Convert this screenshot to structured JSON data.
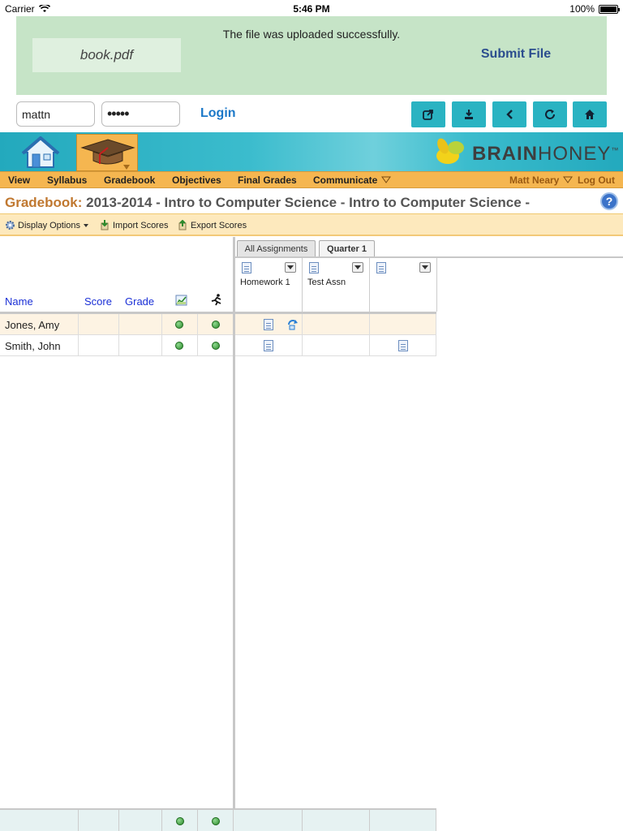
{
  "status_bar": {
    "carrier": "Carrier",
    "time": "5:46 PM",
    "battery": "100%"
  },
  "upload": {
    "message": "The file was uploaded successfully.",
    "file_name": "book.pdf",
    "submit_label": "Submit File"
  },
  "login": {
    "username": "mattn",
    "password": "•••••",
    "login_label": "Login"
  },
  "toolbar_buttons": [
    "share-icon",
    "download-icon",
    "back-icon",
    "refresh-icon",
    "home-icon"
  ],
  "brand": {
    "logo_bold": "BRAIN",
    "logo_light": "HONEY",
    "tm": "™"
  },
  "nav": {
    "items": [
      "View",
      "Syllabus",
      "Gradebook",
      "Objectives",
      "Final Grades",
      "Communicate"
    ],
    "user": "Matt Neary",
    "logout": "Log Out"
  },
  "title": {
    "label": "Gradebook:",
    "course": "2013-2014 - Intro to Computer Science - Intro to Computer Science -",
    "help": "?"
  },
  "grade_toolbar": {
    "display_options": "Display Options",
    "import": "Import Scores",
    "export": "Export Scores"
  },
  "columns": {
    "name": "Name",
    "score": "Score",
    "grade": "Grade"
  },
  "tabs": {
    "all": "All Assignments",
    "quarter": "Quarter 1"
  },
  "assignments": [
    "Homework 1",
    "Test Assn",
    ""
  ],
  "students": [
    {
      "name": "Jones, Amy"
    },
    {
      "name": "Smith, John"
    }
  ],
  "colors": {
    "accent": "#f5b650",
    "teal": "#2ab3c2",
    "link": "#1b78c8"
  }
}
